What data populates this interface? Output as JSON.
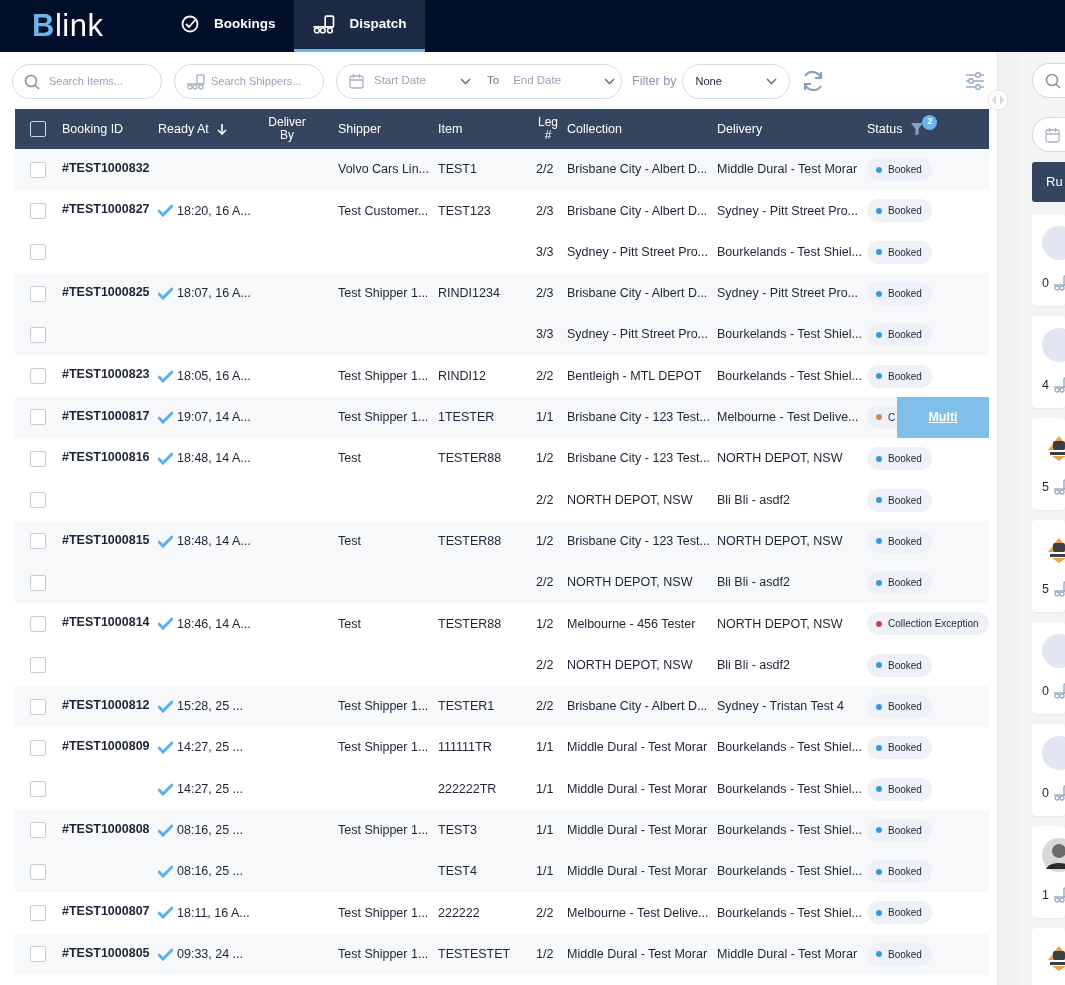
{
  "nav": {
    "brand": "Blink",
    "tabs": [
      {
        "label": "Bookings",
        "selected": false
      },
      {
        "label": "Dispatch",
        "selected": true
      }
    ]
  },
  "toolbar": {
    "search_items": {
      "placeholder": "Search Items..."
    },
    "search_shippers": {
      "placeholder": "Search Shippers..."
    },
    "start_date": {
      "placeholder": "Start Date"
    },
    "to_label": "To",
    "end_date": {
      "placeholder": "End Date"
    },
    "filter_label": "Filter by",
    "filter": {
      "value": "None"
    }
  },
  "table": {
    "select_all_checked": false,
    "columns": [
      "Booking ID",
      "Ready At",
      "Deliver By",
      "Shipper",
      "Item",
      "Leg #",
      "Collection",
      "Delivery",
      "Status"
    ],
    "status_filter_count": "2",
    "bookings": [
      {
        "id": "#TEST1000832",
        "legs": [
          {
            "checked": false,
            "shipper": "Volvo Cars Lin...",
            "item": "TEST1",
            "leg": "2/2",
            "collection": "Brisbane City - Albert D...",
            "delivery": "Middle Dural - Test Morar",
            "status": "Booked",
            "color": "#2f9be3"
          }
        ]
      },
      {
        "id": "#TEST1000827",
        "legs": [
          {
            "checked": false,
            "ready_at": "18:20, 16 A...",
            "shipper": "Test Customer...",
            "item": "TEST123",
            "leg": "2/3",
            "collection": "Brisbane City - Albert D...",
            "delivery": "Sydney - Pitt Street Pro...",
            "status": "Booked",
            "color": "#2f9be3"
          },
          {
            "checked": false,
            "leg": "3/3",
            "collection": "Sydney - Pitt Street Pro...",
            "delivery": "Bourkelands - Test Shiel...",
            "status": "Booked",
            "color": "#2f9be3"
          }
        ]
      },
      {
        "id": "#TEST1000825",
        "legs": [
          {
            "checked": false,
            "ready_at": "18:07, 16 A...",
            "shipper": "Test Shipper 1...",
            "item": "RINDI1234",
            "leg": "2/3",
            "collection": "Brisbane City - Albert D...",
            "delivery": "Sydney - Pitt Street Pro...",
            "status": "Booked",
            "color": "#2f9be3"
          },
          {
            "checked": false,
            "leg": "3/3",
            "collection": "Sydney - Pitt Street Pro...",
            "delivery": "Bourkelands - Test Shiel...",
            "status": "Booked",
            "color": "#2f9be3"
          }
        ]
      },
      {
        "id": "#TEST1000823",
        "legs": [
          {
            "checked": false,
            "ready_at": "18:05, 16 A...",
            "shipper": "Test Shipper 1...",
            "item": "RINDI12",
            "leg": "2/2",
            "collection": "Bentleigh - MTL DEPOT",
            "delivery": "Bourkelands - Test Shiel...",
            "status": "Booked",
            "color": "#2f9be3"
          }
        ]
      },
      {
        "id": "#TEST1000817",
        "drag_label": "Multi",
        "legs": [
          {
            "checked": false,
            "ready_at": "19:07, 14 A...",
            "shipper": "Test Shipper 1...",
            "item": "1TESTER",
            "leg": "1/1",
            "collection": "Brisbane City - 123 Test...",
            "delivery": "Melbourne - Test Delive...",
            "status": "C",
            "color": "#c98a6a"
          }
        ]
      },
      {
        "id": "#TEST1000816",
        "legs": [
          {
            "checked": false,
            "ready_at": "18:48, 14 A...",
            "shipper": "Test",
            "item": "TESTER88",
            "leg": "1/2",
            "collection": "Brisbane City - 123 Test...",
            "delivery": "NORTH DEPOT, NSW",
            "status": "Booked",
            "color": "#2f9be3"
          },
          {
            "checked": false,
            "leg": "2/2",
            "collection": "NORTH DEPOT, NSW",
            "delivery": "Bli Bli - asdf2",
            "status": "Booked",
            "color": "#2f9be3"
          }
        ]
      },
      {
        "id": "#TEST1000815",
        "legs": [
          {
            "checked": false,
            "ready_at": "18:48, 14 A...",
            "shipper": "Test",
            "item": "TESTER88",
            "leg": "1/2",
            "collection": "Brisbane City - 123 Test...",
            "delivery": "NORTH DEPOT, NSW",
            "status": "Booked",
            "color": "#2f9be3"
          },
          {
            "checked": false,
            "leg": "2/2",
            "collection": "NORTH DEPOT, NSW",
            "delivery": "Bli Bli - asdf2",
            "status": "Booked",
            "color": "#2f9be3"
          }
        ]
      },
      {
        "id": "#TEST1000814",
        "legs": [
          {
            "checked": false,
            "ready_at": "18:46, 14 A...",
            "shipper": "Test",
            "item": "TESTER88",
            "leg": "1/2",
            "collection": "Melbourne - 456 Tester",
            "delivery": "NORTH DEPOT, NSW",
            "status": "Collection Exception",
            "color": "#c0474f"
          },
          {
            "checked": false,
            "leg": "2/2",
            "collection": "NORTH DEPOT, NSW",
            "delivery": "Bli Bli - asdf2",
            "status": "Booked",
            "color": "#2f9be3"
          }
        ]
      },
      {
        "id": "#TEST1000812",
        "legs": [
          {
            "checked": false,
            "ready_at": "15:28, 25 ...",
            "shipper": "Test Shipper 1...",
            "item": "TESTER1",
            "leg": "2/2",
            "collection": "Brisbane City - Albert D...",
            "delivery": "Sydney - Tristan Test 4",
            "status": "Booked",
            "color": "#2f9be3"
          }
        ]
      },
      {
        "id": "#TEST1000809",
        "legs": [
          {
            "checked": false,
            "ready_at": "14:27, 25 ...",
            "shipper": "Test Shipper 1...",
            "item": "111111TR",
            "leg": "1/1",
            "collection": "Middle Dural - Test Morar",
            "delivery": "Bourkelands - Test Shiel...",
            "status": "Booked",
            "color": "#2f9be3"
          },
          {
            "checked": false,
            "ready_at": "14:27, 25 ...",
            "item": "222222TR",
            "leg": "1/1",
            "collection": "Middle Dural - Test Morar",
            "delivery": "Bourkelands - Test Shiel...",
            "status": "Booked",
            "color": "#2f9be3"
          }
        ]
      },
      {
        "id": "#TEST1000808",
        "legs": [
          {
            "checked": false,
            "ready_at": "08:16, 25 ...",
            "shipper": "Test Shipper 1...",
            "item": "TEST3",
            "leg": "1/1",
            "collection": "Middle Dural - Test Morar",
            "delivery": "Bourkelands - Test Shiel...",
            "status": "Booked",
            "color": "#2f9be3"
          },
          {
            "checked": false,
            "ready_at": "08:16, 25 ...",
            "item": "TEST4",
            "leg": "1/1",
            "collection": "Middle Dural - Test Morar",
            "delivery": "Bourkelands - Test Shiel...",
            "status": "Booked",
            "color": "#2f9be3"
          }
        ]
      },
      {
        "id": "#TEST1000807",
        "legs": [
          {
            "checked": false,
            "ready_at": "18:11, 16 A...",
            "shipper": "Test Shipper 1...",
            "item": "222222",
            "leg": "2/2",
            "collection": "Melbourne - Test Delive...",
            "delivery": "Bourkelands - Test Shiel...",
            "status": "Booked",
            "color": "#2f9be3"
          }
        ]
      },
      {
        "id": "#TEST1000805",
        "legs": [
          {
            "checked": false,
            "ready_at": "09:33, 24 ...",
            "shipper": "Test Shipper 1...",
            "item": "TESTESTET",
            "leg": "1/2",
            "collection": "Middle Dural - Test Morar",
            "delivery": "Middle Dural - Test Morar",
            "status": "Booked",
            "color": "#2f9be3"
          }
        ]
      }
    ]
  },
  "side_panel": {
    "run_button": "Ru",
    "drivers": [
      {
        "kind": "blank",
        "count": "0"
      },
      {
        "kind": "blank",
        "count": "4"
      },
      {
        "kind": "logo",
        "count": "5"
      },
      {
        "kind": "logo",
        "count": "5"
      },
      {
        "kind": "blank",
        "count": "0"
      },
      {
        "kind": "blank",
        "count": "0"
      },
      {
        "count": "1"
      },
      {
        "kind": "logo"
      }
    ]
  }
}
